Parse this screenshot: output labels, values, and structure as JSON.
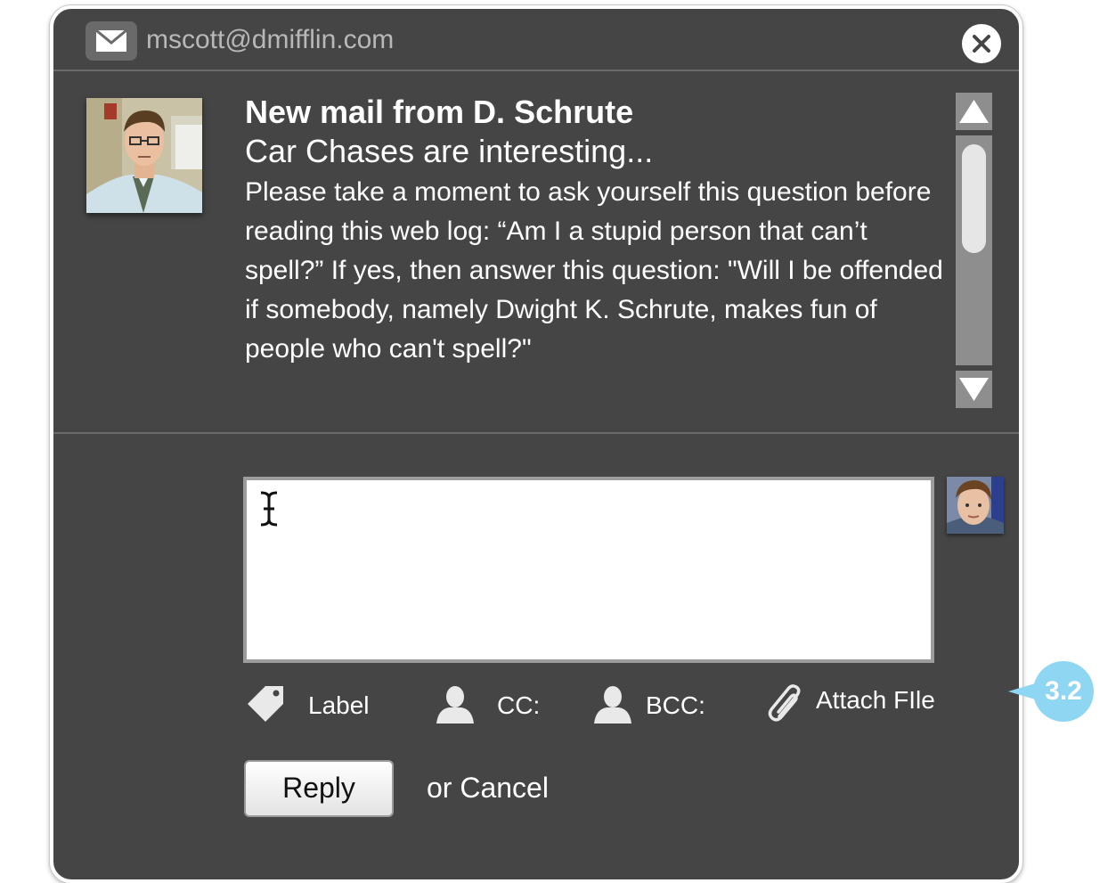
{
  "window": {
    "account_email": "mscott@dmifflin.com",
    "close_icon": "close-icon",
    "mail_icon": "envelope-icon"
  },
  "message": {
    "title": "New mail from D. Schrute",
    "subject": "Car Chases are interesting...",
    "body": "Please take a moment to ask yourself this question before reading this web log: “Am I a stupid person that can’t spell?” If yes, then answer this question: \"Will I be offended if somebody, namely Dwight K. Schrute, makes fun of people who can't spell?\"",
    "sender_avatar_icon": "sender-photo"
  },
  "scrollbar": {
    "up_icon": "arrow-up-icon",
    "down_icon": "arrow-down-icon",
    "thumb_position": 0
  },
  "compose": {
    "reply_text": "",
    "me_avatar_icon": "user-photo",
    "tools": [
      {
        "label": "Label",
        "icon": "tag-icon"
      },
      {
        "label": "CC:",
        "icon": "person-icon"
      },
      {
        "label": "BCC:",
        "icon": "person-icon"
      },
      {
        "label": "Attach FIle",
        "icon": "paperclip-icon"
      }
    ],
    "reply_button": "Reply",
    "cancel_link": "or Cancel"
  },
  "callout": {
    "label": "3.2",
    "color": "#8fd6f3"
  }
}
